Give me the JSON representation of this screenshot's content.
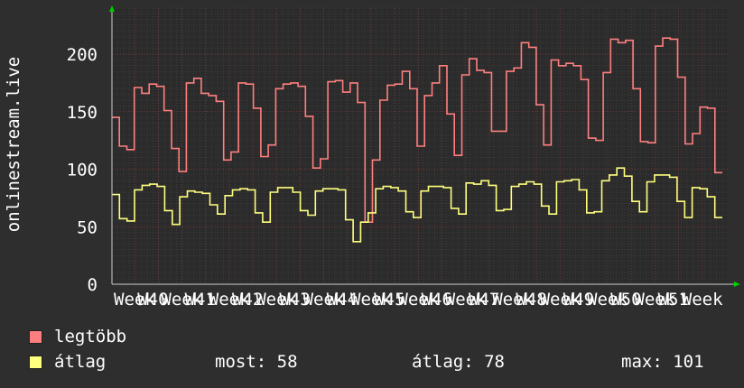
{
  "chart_data": {
    "type": "line",
    "ylabel": "onlinestream.live",
    "ylim": [
      0,
      240
    ],
    "yticks": [
      0,
      50,
      100,
      150,
      200
    ],
    "grid": true,
    "x_tick_labels": [
      "Week",
      "W40",
      "Week",
      "W41",
      "Week",
      "W42",
      "Week",
      "W43",
      "Week",
      "W44",
      "Week",
      "W45",
      "Week",
      "W46",
      "Week",
      "W47",
      "Week",
      "W48",
      "Week",
      "W49",
      "Week",
      "W50",
      "Week",
      "W51",
      "Week"
    ],
    "colors": {
      "legtobb": "#ff7f7f",
      "atlag": "#ffff7f"
    },
    "series": [
      {
        "name": "legtöbb",
        "values": [
          145,
          120,
          117,
          171,
          166,
          174,
          172,
          151,
          118,
          98,
          175,
          179,
          166,
          164,
          159,
          108,
          115,
          175,
          174,
          153,
          111,
          121,
          170,
          174,
          175,
          172,
          146,
          101,
          109,
          176,
          177,
          167,
          175,
          158,
          54,
          108,
          160,
          173,
          174,
          185,
          170,
          120,
          164,
          175,
          190,
          148,
          112,
          182,
          196,
          186,
          184,
          133,
          133,
          185,
          188,
          210,
          206,
          156,
          121,
          195,
          190,
          192,
          190,
          178,
          127,
          125,
          184,
          213,
          210,
          212,
          170,
          124,
          123,
          207,
          214,
          213,
          180,
          122,
          131,
          154,
          153,
          97
        ]
      },
      {
        "name": "átlag",
        "values": [
          78,
          57,
          55,
          82,
          86,
          87,
          85,
          64,
          52,
          76,
          81,
          80,
          79,
          69,
          61,
          77,
          82,
          83,
          82,
          62,
          54,
          80,
          84,
          84,
          80,
          64,
          60,
          81,
          83,
          83,
          82,
          56,
          37,
          54,
          62,
          83,
          85,
          84,
          81,
          63,
          58,
          81,
          85,
          85,
          84,
          66,
          61,
          88,
          87,
          90,
          86,
          64,
          65,
          85,
          87,
          89,
          87,
          68,
          61,
          89,
          90,
          91,
          82,
          62,
          63,
          90,
          95,
          101,
          94,
          72,
          63,
          89,
          95,
          95,
          93,
          72,
          58,
          84,
          83,
          76,
          58
        ]
      }
    ]
  },
  "legend": [
    {
      "label": "legtöbb",
      "color": "#ff7f7f"
    },
    {
      "label": "átlag",
      "color": "#ffff7f"
    }
  ],
  "stats": {
    "most": "most: 58",
    "atlag": "átlag: 78",
    "max": "max: 101"
  }
}
